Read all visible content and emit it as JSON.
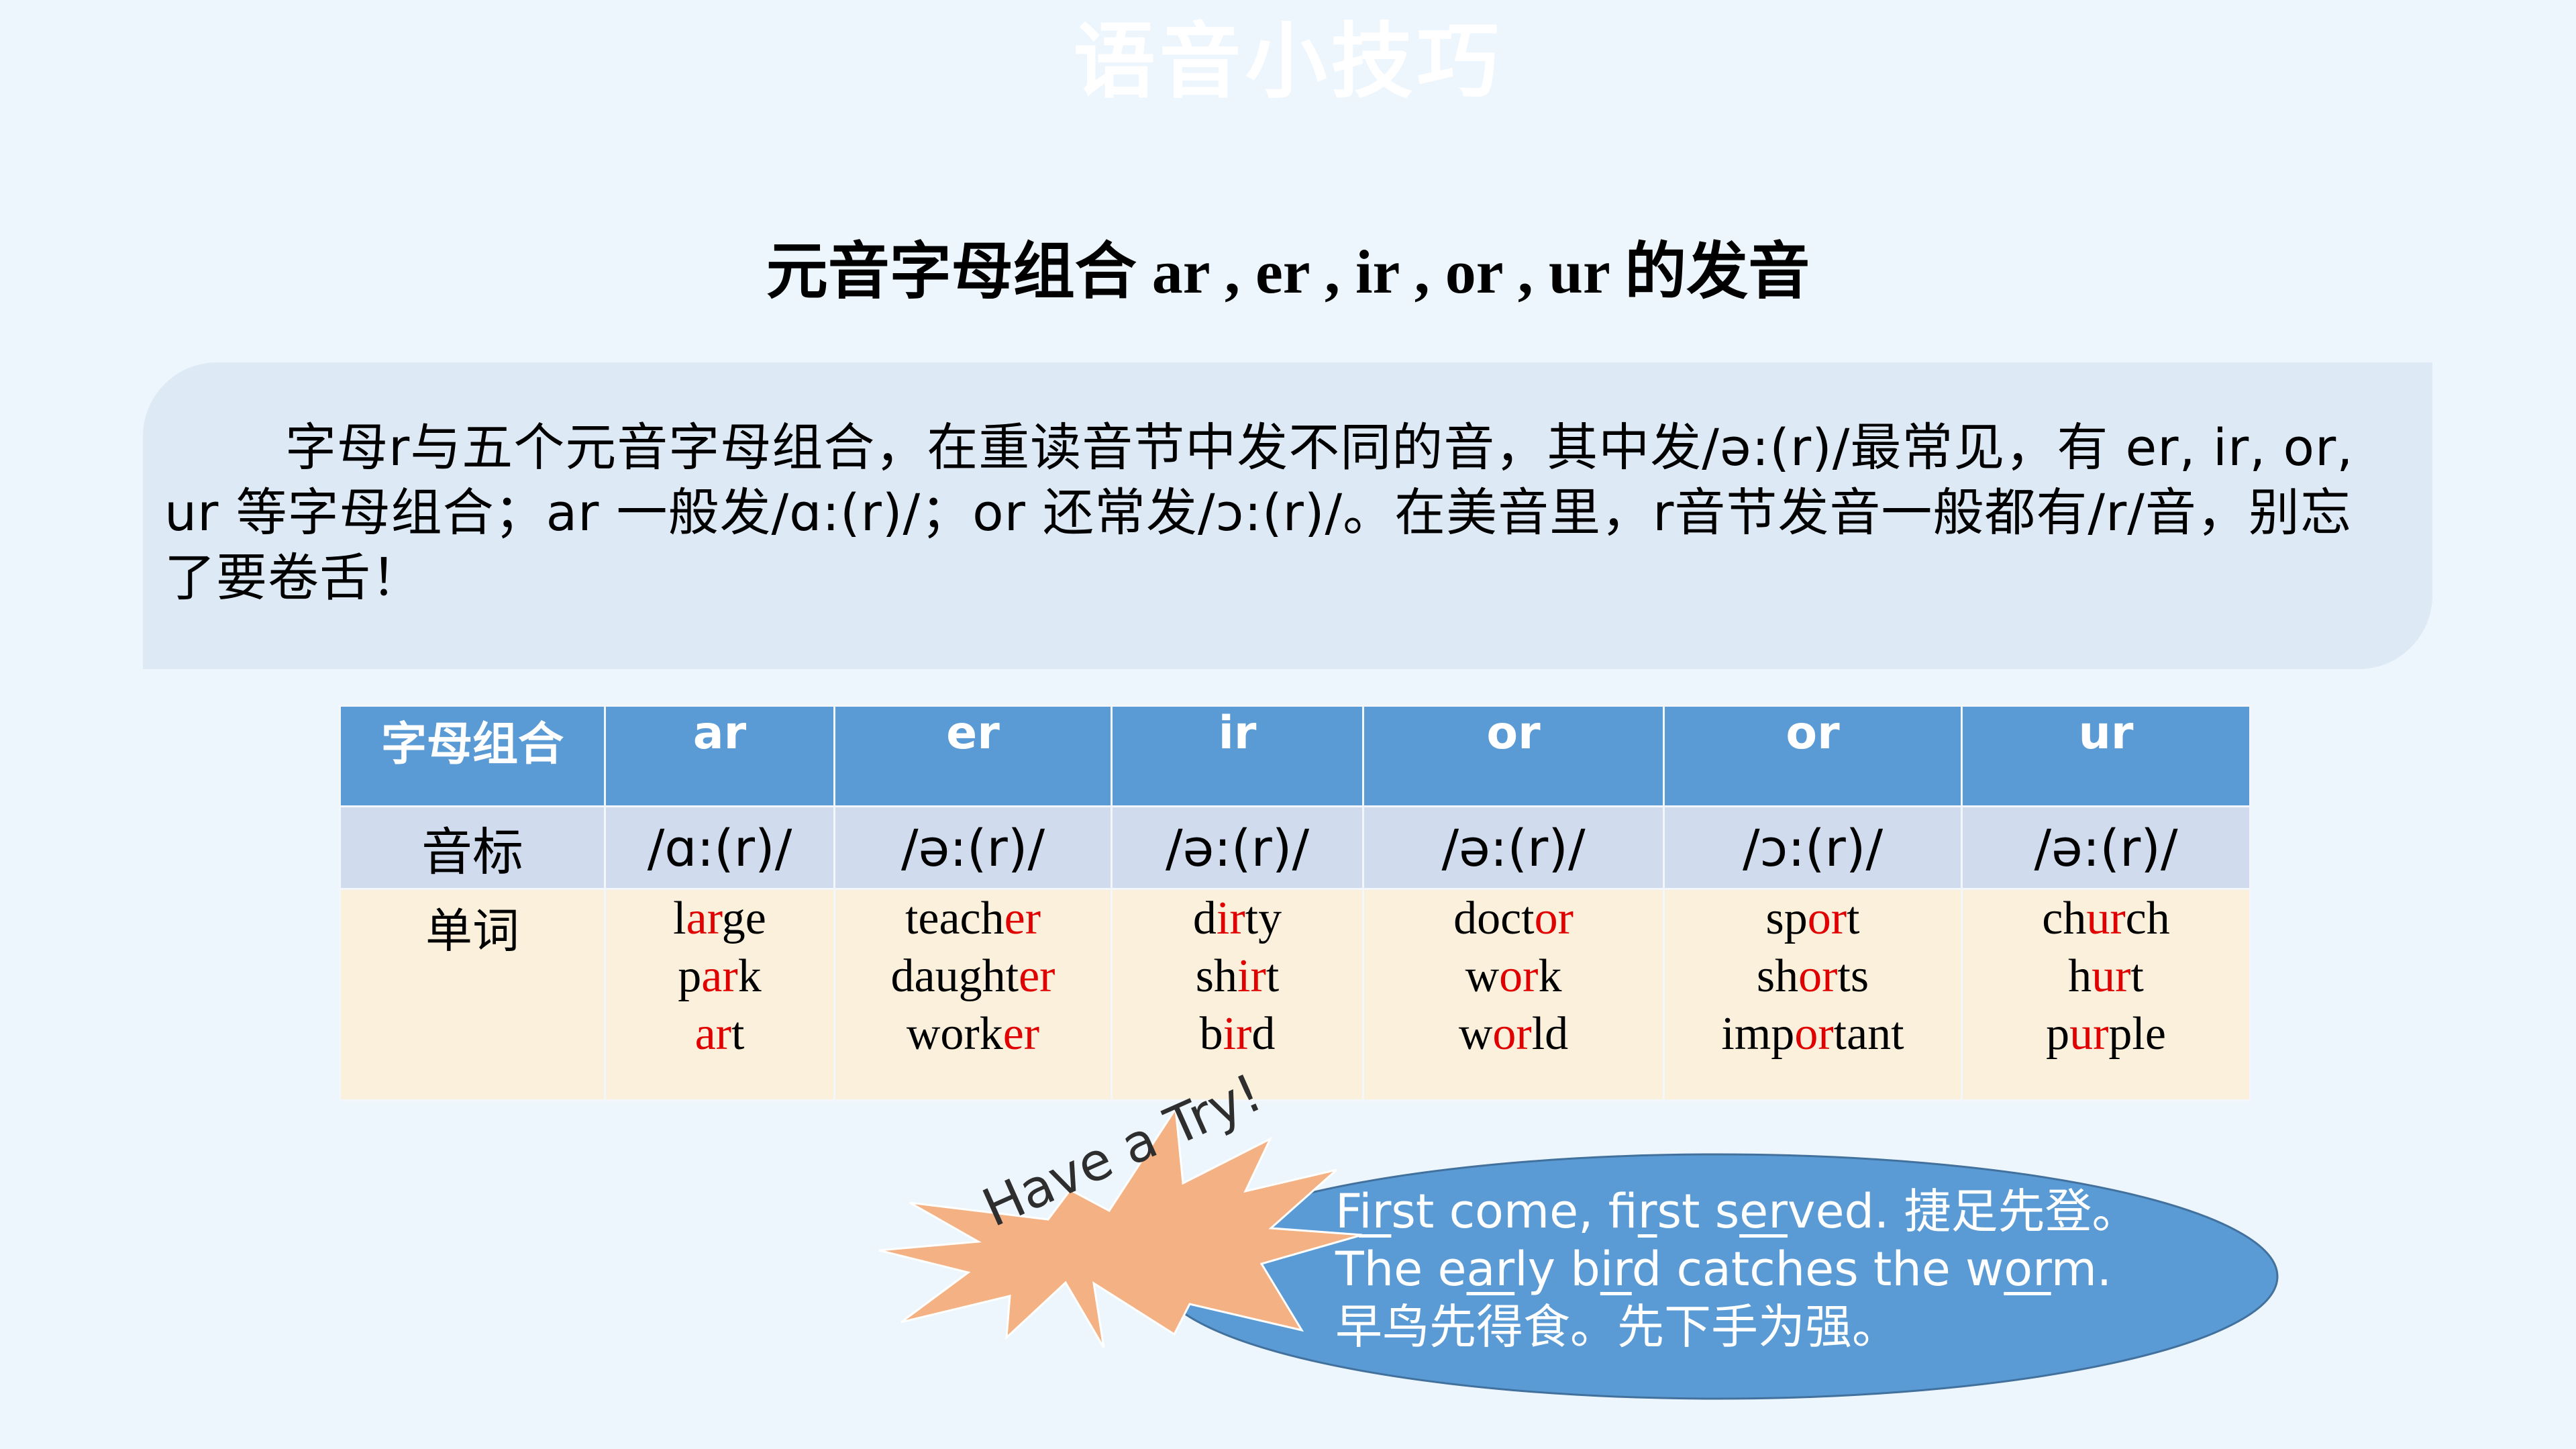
{
  "slide": {
    "title": "语音小技巧",
    "subtitle": "元音字母组合 ar , er , ir , or , ur 的发音",
    "intro": "字母r与五个元音字母组合，在重读音节中发不同的音，其中发/ə:(r)/最常见，有 er, ir, or, ur 等字母组合；ar 一般发/ɑ:(r)/；or 还常发/ɔ:(r)/。在美音里，r音节发音一般都有/r/音，别忘了要卷舌！"
  },
  "colors": {
    "background": "#EEF6FD",
    "intro_box": "#DDE9F5",
    "header_row": "#5B9BD5",
    "phonetic_row": "#D0DCEE",
    "words_row": "#FAF0DC",
    "highlight": "#E00000",
    "burst": "#F4B183",
    "bubble": "#5B9BD5"
  },
  "table": {
    "row_labels": [
      "字母组合",
      "音标",
      "单词"
    ],
    "columns": [
      {
        "combo": "ar",
        "phonetic": "/ɑ:(r)/",
        "words": [
          {
            "pre": "l",
            "hl": "ar",
            "post": "ge"
          },
          {
            "pre": "p",
            "hl": "ar",
            "post": "k"
          },
          {
            "pre": "",
            "hl": "ar",
            "post": "t"
          }
        ]
      },
      {
        "combo": "er",
        "phonetic": "/ə:(r)/",
        "words": [
          {
            "pre": "teach",
            "hl": "er",
            "post": ""
          },
          {
            "pre": "daught",
            "hl": "er",
            "post": ""
          },
          {
            "pre": "work",
            "hl": "er",
            "post": ""
          }
        ]
      },
      {
        "combo": "ir",
        "phonetic": "/ə:(r)/",
        "words": [
          {
            "pre": "d",
            "hl": "ir",
            "post": "ty"
          },
          {
            "pre": "sh",
            "hl": "ir",
            "post": "t"
          },
          {
            "pre": "b",
            "hl": "ir",
            "post": "d"
          }
        ]
      },
      {
        "combo": "or",
        "phonetic": "/ə:(r)/",
        "words": [
          {
            "pre": "doct",
            "hl": "or",
            "post": ""
          },
          {
            "pre": "w",
            "hl": "or",
            "post": "k"
          },
          {
            "pre": "w",
            "hl": "or",
            "post": "ld"
          }
        ]
      },
      {
        "combo": "or",
        "phonetic": "/ɔ:(r)/",
        "words": [
          {
            "pre": "sp",
            "hl": "or",
            "post": "t"
          },
          {
            "pre": "sh",
            "hl": "or",
            "post": "ts"
          },
          {
            "pre": "imp",
            "hl": "or",
            "post": "tant"
          }
        ]
      },
      {
        "combo": "ur",
        "phonetic": "/ə:(r)/",
        "words": [
          {
            "pre": "ch",
            "hl": "ur",
            "post": "ch"
          },
          {
            "pre": "h",
            "hl": "ur",
            "post": "t"
          },
          {
            "pre": "p",
            "hl": "ur",
            "post": "ple"
          }
        ]
      }
    ]
  },
  "practice": {
    "burst_label": "Have a Try!",
    "lines": [
      [
        {
          "t": "F",
          "u": false
        },
        {
          "t": "ir",
          "u": true
        },
        {
          "t": "st come, f",
          "u": false
        },
        {
          "t": "ir",
          "u": true
        },
        {
          "t": "st s",
          "u": false
        },
        {
          "t": "er",
          "u": true
        },
        {
          "t": "ved. 捷足先登。",
          "u": false
        }
      ],
      [
        {
          "t": "The e",
          "u": false
        },
        {
          "t": "ar",
          "u": true
        },
        {
          "t": "ly b",
          "u": false
        },
        {
          "t": "ir",
          "u": true
        },
        {
          "t": "d catches the w",
          "u": false
        },
        {
          "t": "or",
          "u": true
        },
        {
          "t": "m.",
          "u": false
        }
      ],
      [
        {
          "t": "早鸟先得食。先下手为强。",
          "u": false
        }
      ]
    ]
  }
}
